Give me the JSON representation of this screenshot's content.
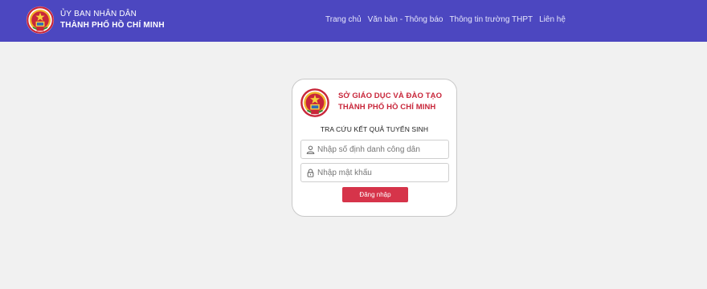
{
  "header": {
    "org_line1": "ỦY BAN NHÂN DÂN",
    "org_line2": "THÀNH PHỐ HỒ CHÍ MINH",
    "logo_icon": "city-emblem-icon",
    "nav": [
      {
        "label": "Trang chủ"
      },
      {
        "label": "Văn bản - Thông báo"
      },
      {
        "label": "Thông tin trường THPT"
      },
      {
        "label": "Liên hệ"
      }
    ]
  },
  "login_card": {
    "org_line1": "SỞ GIÁO DỤC VÀ ĐÀO TẠO",
    "org_line2": "THÀNH PHỐ HỒ CHÍ MINH",
    "subtitle": "TRA CỨU KẾT QUẢ TUYỂN SINH",
    "logo_icon": "city-emblem-icon",
    "id_field": {
      "placeholder": "Nhập số định danh công dân",
      "value": "",
      "icon": "user-icon"
    },
    "password_field": {
      "placeholder": "Nhập mật khẩu",
      "value": "",
      "icon": "lock-icon"
    },
    "login_button": "Đăng nhập"
  },
  "colors": {
    "header_bg": "#4c47c0",
    "page_bg": "#f1f1f1",
    "accent_red": "#d6344a",
    "title_red": "#c8263a"
  }
}
